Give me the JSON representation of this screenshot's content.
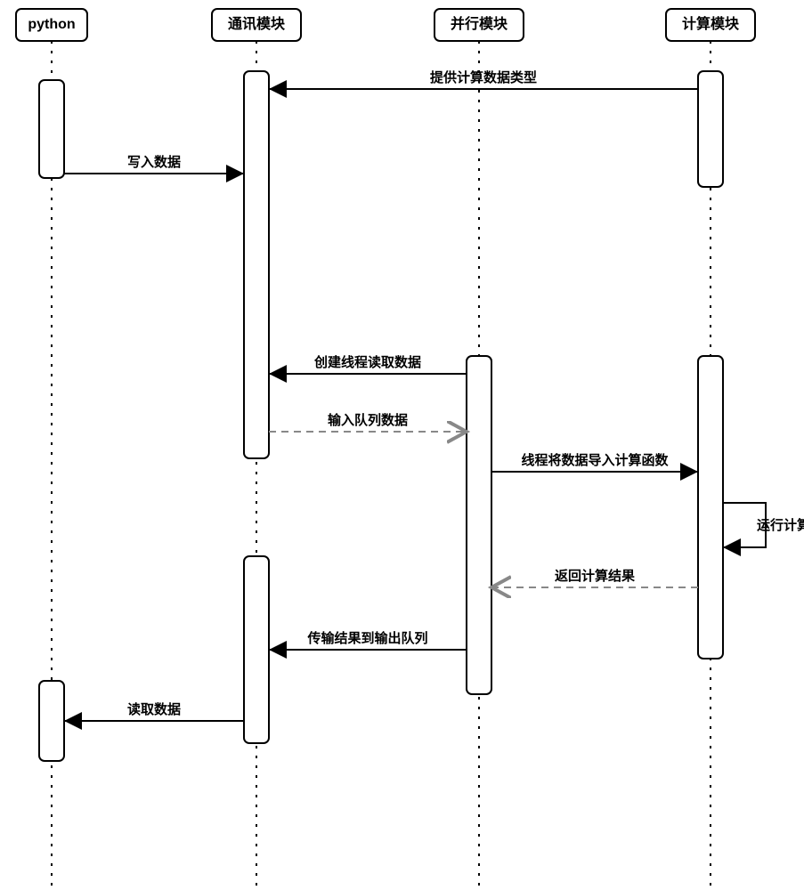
{
  "lanes": {
    "python": "python",
    "comm": "通讯模块",
    "parallel": "并行模块",
    "compute": "计算模块"
  },
  "messages": {
    "provide_type": "提供计算数据类型",
    "write_data": "写入数据",
    "create_thread": "创建线程读取数据",
    "input_queue": "输入队列数据",
    "import_compute": "线程将数据导入计算函数",
    "run_compute": "运行计算函数",
    "return_result": "返回计算结果",
    "transfer_output": "传输结果到输出队列",
    "read_data": "读取数据"
  }
}
